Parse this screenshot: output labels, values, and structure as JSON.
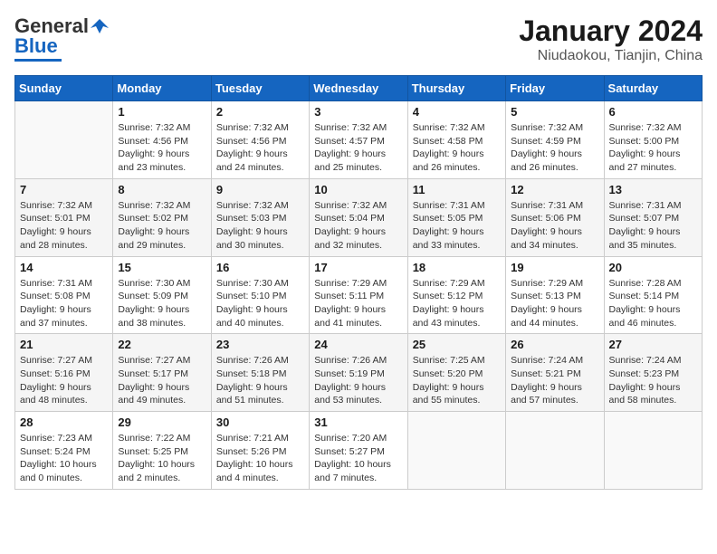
{
  "header": {
    "logo_general": "General",
    "logo_blue": "Blue",
    "month_title": "January 2024",
    "location": "Niudaokou, Tianjin, China"
  },
  "weekdays": [
    "Sunday",
    "Monday",
    "Tuesday",
    "Wednesday",
    "Thursday",
    "Friday",
    "Saturday"
  ],
  "weeks": [
    [
      {
        "day": "",
        "empty": true
      },
      {
        "day": "1",
        "sunrise": "7:32 AM",
        "sunset": "4:56 PM",
        "daylight": "9 hours and 23 minutes."
      },
      {
        "day": "2",
        "sunrise": "7:32 AM",
        "sunset": "4:56 PM",
        "daylight": "9 hours and 24 minutes."
      },
      {
        "day": "3",
        "sunrise": "7:32 AM",
        "sunset": "4:57 PM",
        "daylight": "9 hours and 25 minutes."
      },
      {
        "day": "4",
        "sunrise": "7:32 AM",
        "sunset": "4:58 PM",
        "daylight": "9 hours and 26 minutes."
      },
      {
        "day": "5",
        "sunrise": "7:32 AM",
        "sunset": "4:59 PM",
        "daylight": "9 hours and 26 minutes."
      },
      {
        "day": "6",
        "sunrise": "7:32 AM",
        "sunset": "5:00 PM",
        "daylight": "9 hours and 27 minutes."
      }
    ],
    [
      {
        "day": "7",
        "sunrise": "7:32 AM",
        "sunset": "5:01 PM",
        "daylight": "9 hours and 28 minutes."
      },
      {
        "day": "8",
        "sunrise": "7:32 AM",
        "sunset": "5:02 PM",
        "daylight": "9 hours and 29 minutes."
      },
      {
        "day": "9",
        "sunrise": "7:32 AM",
        "sunset": "5:03 PM",
        "daylight": "9 hours and 30 minutes."
      },
      {
        "day": "10",
        "sunrise": "7:32 AM",
        "sunset": "5:04 PM",
        "daylight": "9 hours and 32 minutes."
      },
      {
        "day": "11",
        "sunrise": "7:31 AM",
        "sunset": "5:05 PM",
        "daylight": "9 hours and 33 minutes."
      },
      {
        "day": "12",
        "sunrise": "7:31 AM",
        "sunset": "5:06 PM",
        "daylight": "9 hours and 34 minutes."
      },
      {
        "day": "13",
        "sunrise": "7:31 AM",
        "sunset": "5:07 PM",
        "daylight": "9 hours and 35 minutes."
      }
    ],
    [
      {
        "day": "14",
        "sunrise": "7:31 AM",
        "sunset": "5:08 PM",
        "daylight": "9 hours and 37 minutes."
      },
      {
        "day": "15",
        "sunrise": "7:30 AM",
        "sunset": "5:09 PM",
        "daylight": "9 hours and 38 minutes."
      },
      {
        "day": "16",
        "sunrise": "7:30 AM",
        "sunset": "5:10 PM",
        "daylight": "9 hours and 40 minutes."
      },
      {
        "day": "17",
        "sunrise": "7:29 AM",
        "sunset": "5:11 PM",
        "daylight": "9 hours and 41 minutes."
      },
      {
        "day": "18",
        "sunrise": "7:29 AM",
        "sunset": "5:12 PM",
        "daylight": "9 hours and 43 minutes."
      },
      {
        "day": "19",
        "sunrise": "7:29 AM",
        "sunset": "5:13 PM",
        "daylight": "9 hours and 44 minutes."
      },
      {
        "day": "20",
        "sunrise": "7:28 AM",
        "sunset": "5:14 PM",
        "daylight": "9 hours and 46 minutes."
      }
    ],
    [
      {
        "day": "21",
        "sunrise": "7:27 AM",
        "sunset": "5:16 PM",
        "daylight": "9 hours and 48 minutes."
      },
      {
        "day": "22",
        "sunrise": "7:27 AM",
        "sunset": "5:17 PM",
        "daylight": "9 hours and 49 minutes."
      },
      {
        "day": "23",
        "sunrise": "7:26 AM",
        "sunset": "5:18 PM",
        "daylight": "9 hours and 51 minutes."
      },
      {
        "day": "24",
        "sunrise": "7:26 AM",
        "sunset": "5:19 PM",
        "daylight": "9 hours and 53 minutes."
      },
      {
        "day": "25",
        "sunrise": "7:25 AM",
        "sunset": "5:20 PM",
        "daylight": "9 hours and 55 minutes."
      },
      {
        "day": "26",
        "sunrise": "7:24 AM",
        "sunset": "5:21 PM",
        "daylight": "9 hours and 57 minutes."
      },
      {
        "day": "27",
        "sunrise": "7:24 AM",
        "sunset": "5:23 PM",
        "daylight": "9 hours and 58 minutes."
      }
    ],
    [
      {
        "day": "28",
        "sunrise": "7:23 AM",
        "sunset": "5:24 PM",
        "daylight": "10 hours and 0 minutes."
      },
      {
        "day": "29",
        "sunrise": "7:22 AM",
        "sunset": "5:25 PM",
        "daylight": "10 hours and 2 minutes."
      },
      {
        "day": "30",
        "sunrise": "7:21 AM",
        "sunset": "5:26 PM",
        "daylight": "10 hours and 4 minutes."
      },
      {
        "day": "31",
        "sunrise": "7:20 AM",
        "sunset": "5:27 PM",
        "daylight": "10 hours and 7 minutes."
      },
      {
        "day": "",
        "empty": true
      },
      {
        "day": "",
        "empty": true
      },
      {
        "day": "",
        "empty": true
      }
    ]
  ]
}
